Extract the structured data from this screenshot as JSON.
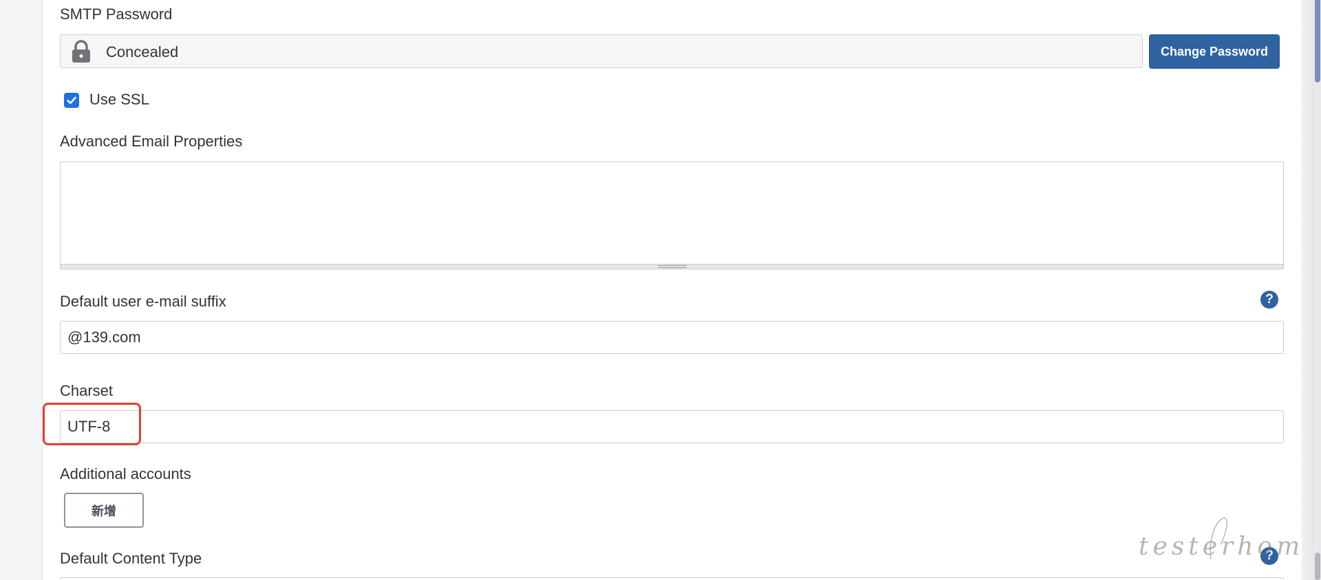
{
  "smtp_password": {
    "label": "SMTP Password",
    "value": "Concealed",
    "lock_icon": "lock-icon",
    "change_button": "Change Password"
  },
  "use_ssl": {
    "label": "Use SSL",
    "checked": true
  },
  "advanced_email": {
    "label": "Advanced Email Properties",
    "value": ""
  },
  "default_suffix": {
    "label": "Default user e-mail suffix",
    "value": "@139.com",
    "help_icon": "help-icon"
  },
  "charset": {
    "label": "Charset",
    "value": "UTF-8"
  },
  "additional_accounts": {
    "label": "Additional accounts",
    "add_button": "新增"
  },
  "default_content_type": {
    "label": "Default Content Type",
    "help_icon": "help-icon"
  },
  "watermark": "testerhome.com",
  "colors": {
    "primary_button": "#2f62a1",
    "checkbox": "#1f6fe6",
    "highlight": "#e0402f"
  }
}
